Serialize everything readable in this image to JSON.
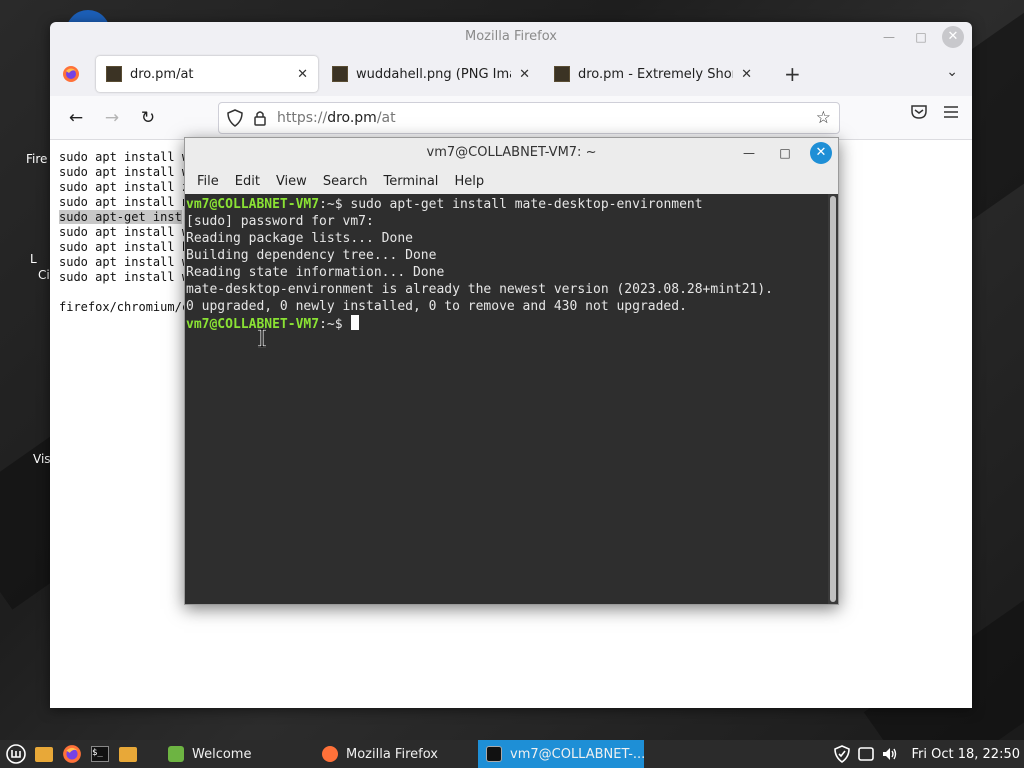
{
  "desktop": {
    "labels": [
      "Fire",
      "L",
      "Ci",
      "Vis"
    ]
  },
  "firefox": {
    "title": "Mozilla Firefox",
    "tabs": [
      {
        "label": "dro.pm/at",
        "active": true
      },
      {
        "label": "wuddahell.png (PNG Image",
        "active": false
      },
      {
        "label": "dro.pm - Extremely Short Li",
        "active": false
      }
    ],
    "url": {
      "proto": "https://",
      "host": "dro.pm",
      "path": "/at"
    },
    "page_lines": [
      "sudo apt install w",
      "sudo apt install w",
      "sudo apt install z",
      "sudo apt install n",
      "sudo apt-get inst",
      "sudo apt install w",
      "sudo apt install h",
      "sudo apt install w",
      "sudo apt install w",
      "",
      "firefox/chromium/c"
    ],
    "highlight_index": 4
  },
  "terminal": {
    "title": "vm7@COLLABNET-VM7: ~",
    "menu": [
      "File",
      "Edit",
      "View",
      "Search",
      "Terminal",
      "Help"
    ],
    "prompt_user": "vm7@COLLABNET-VM7",
    "prompt_path": ":~$",
    "command": " sudo apt-get install mate-desktop-environment",
    "output": [
      "[sudo] password for vm7:",
      "Reading package lists... Done",
      "Building dependency tree... Done",
      "Reading state information... Done",
      "mate-desktop-environment is already the newest version (2023.08.28+mint21).",
      "0 upgraded, 0 newly installed, 0 to remove and 430 not upgraded."
    ]
  },
  "taskbar": {
    "tasks": [
      {
        "label": "Welcome",
        "active": false
      },
      {
        "label": "Mozilla Firefox",
        "active": false
      },
      {
        "label": "vm7@COLLABNET-...",
        "active": true
      }
    ],
    "clock": "Fri Oct 18, 22:50"
  },
  "colors": {
    "accent": "#1e8fd6",
    "prompt_green": "#8ae234",
    "terminal_bg": "#2e2e2e"
  }
}
